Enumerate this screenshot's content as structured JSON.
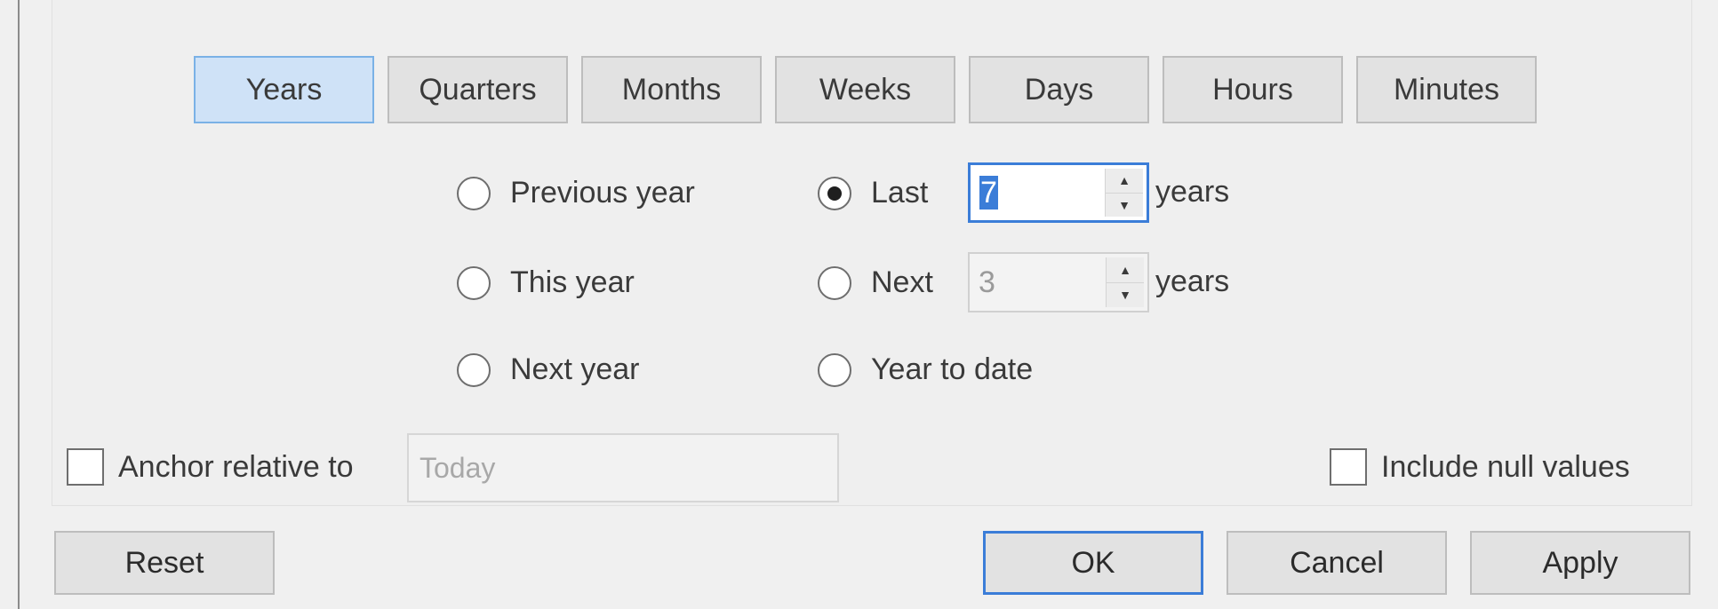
{
  "tabs": [
    {
      "label": "Years",
      "active": true
    },
    {
      "label": "Quarters",
      "active": false
    },
    {
      "label": "Months",
      "active": false
    },
    {
      "label": "Weeks",
      "active": false
    },
    {
      "label": "Days",
      "active": false
    },
    {
      "label": "Hours",
      "active": false
    },
    {
      "label": "Minutes",
      "active": false
    }
  ],
  "options": {
    "previous": {
      "label": "Previous year",
      "checked": false
    },
    "this": {
      "label": "This year",
      "checked": false
    },
    "next_single": {
      "label": "Next year",
      "checked": false
    },
    "last": {
      "label": "Last",
      "checked": true,
      "value": "7",
      "unit": "years"
    },
    "next": {
      "label": "Next",
      "checked": false,
      "value": "3",
      "unit": "years"
    },
    "to_date": {
      "label": "Year to date",
      "checked": false
    }
  },
  "anchor": {
    "label": "Anchor relative to",
    "checked": false,
    "value": "Today"
  },
  "include_null": {
    "label": "Include null values",
    "checked": false
  },
  "buttons": {
    "reset": "Reset",
    "ok": "OK",
    "cancel": "Cancel",
    "apply": "Apply"
  },
  "colors": {
    "accent": "#3b7dd8",
    "active_tab": "#cfe2f7",
    "background": "#f0f0f0"
  }
}
